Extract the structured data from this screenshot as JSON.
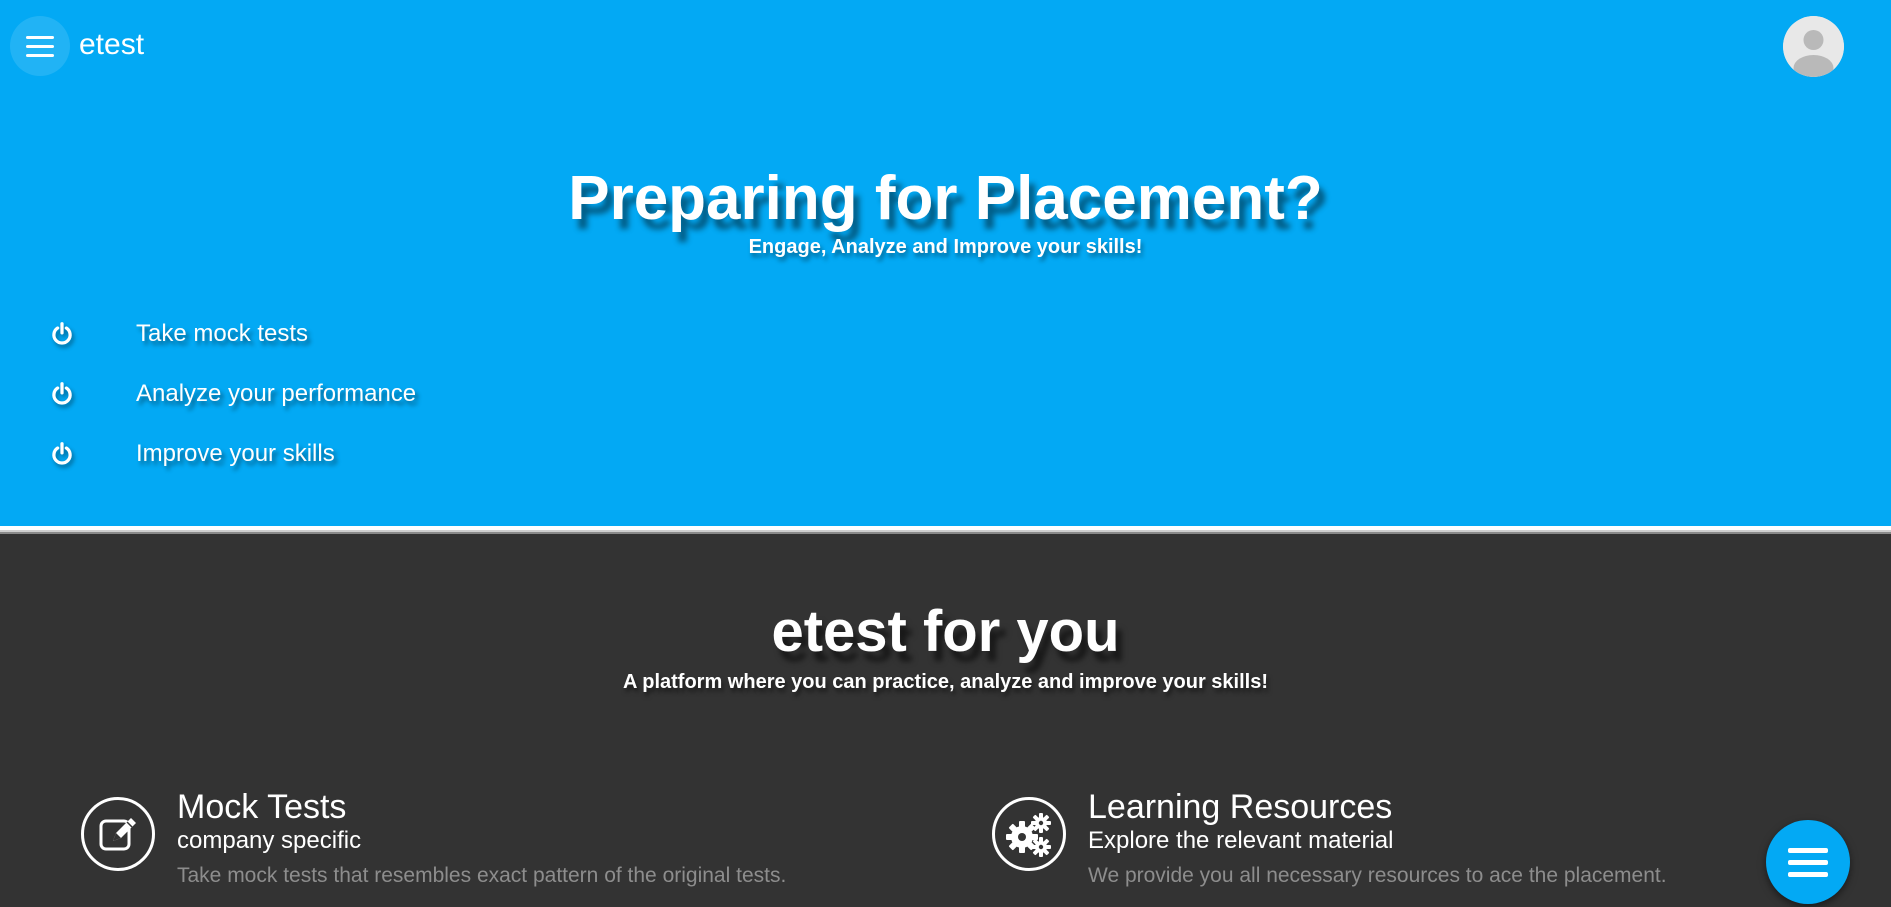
{
  "header": {
    "brand": "etest",
    "menu_icon": "hamburger-menu-icon",
    "avatar_icon": "user-avatar-icon"
  },
  "hero": {
    "title": "Preparing for Placement?",
    "subtitle": "Engage, Analyze and Improve your skills!",
    "features": [
      {
        "label": "Take mock tests",
        "icon": "power-icon"
      },
      {
        "label": "Analyze your performance",
        "icon": "power-icon"
      },
      {
        "label": "Improve your skills",
        "icon": "power-icon"
      }
    ]
  },
  "section": {
    "title": "etest for you",
    "subtitle": "A platform where you can practice, analyze and improve your skills!",
    "cards": [
      {
        "icon": "edit-icon",
        "title": "Mock Tests",
        "subtitle": "company specific",
        "description": "Take mock tests that resembles exact pattern of the original tests."
      },
      {
        "icon": "gears-icon",
        "title": "Learning Resources",
        "subtitle": "Explore the relevant material",
        "description": "We provide you all necessary resources to ace the placement."
      }
    ]
  },
  "fab": {
    "icon": "list-menu-icon"
  },
  "colors": {
    "primary": "#03a9f4",
    "dark_background": "#333333",
    "muted_text": "#8d8d8d",
    "text": "#ffffff"
  }
}
